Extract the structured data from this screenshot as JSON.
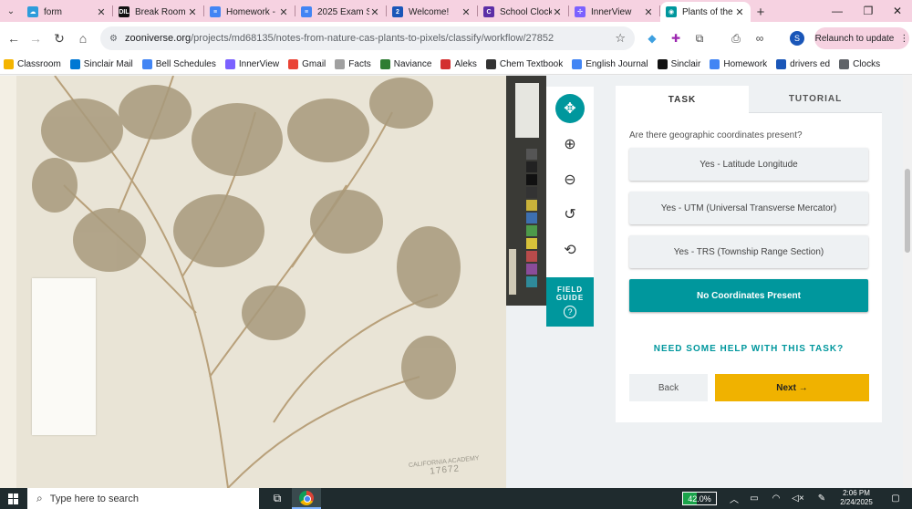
{
  "browser": {
    "tabs": [
      {
        "title": "form",
        "favicon_color": "#2d9cdb",
        "favicon_glyph": "☁"
      },
      {
        "title": "Break Room",
        "favicon_color": "#111111",
        "favicon_glyph": "DIL"
      },
      {
        "title": "Homework -",
        "favicon_color": "#4285f4",
        "favicon_glyph": "≡"
      },
      {
        "title": "2025 Exam S",
        "favicon_color": "#4285f4",
        "favicon_glyph": "≡"
      },
      {
        "title": "Welcome!",
        "favicon_color": "#1a56b8",
        "favicon_glyph": "2"
      },
      {
        "title": "School Clock",
        "favicon_color": "#5b2ea6",
        "favicon_glyph": "C"
      },
      {
        "title": "InnerView",
        "favicon_color": "#7b61ff",
        "favicon_glyph": "✢"
      },
      {
        "title": "Plants of the",
        "favicon_color": "#00979d",
        "favicon_glyph": "◉"
      }
    ],
    "url_domain": "zooniverse.org",
    "url_path": "/projects/md68135/notes-from-nature-cas-plants-to-pixels/classify/workflow/27852",
    "profile_initial": "S",
    "relaunch_label": "Relaunch to update",
    "bookmarks": [
      {
        "label": "Classroom",
        "color": "#f4b400"
      },
      {
        "label": "Sinclair Mail",
        "color": "#0078d4"
      },
      {
        "label": "Bell Schedules",
        "color": "#4285f4"
      },
      {
        "label": "InnerView",
        "color": "#7b61ff"
      },
      {
        "label": "Gmail",
        "color": "#ea4335"
      },
      {
        "label": "Facts",
        "color": "#a0a0a0"
      },
      {
        "label": "Naviance",
        "color": "#2e7d32"
      },
      {
        "label": "Aleks",
        "color": "#d32f2f"
      },
      {
        "label": "Chem Textbook",
        "color": "#333333"
      },
      {
        "label": "English Journal",
        "color": "#4285f4"
      },
      {
        "label": "Sinclair",
        "color": "#111111"
      },
      {
        "label": "Homework",
        "color": "#4285f4"
      },
      {
        "label": "drivers ed",
        "color": "#1a56b8"
      },
      {
        "label": "Clocks",
        "color": "#5f6368"
      }
    ]
  },
  "specimen": {
    "stamp_line1": "CALIFORNIA ACADEMY",
    "stamp_line2": "17672"
  },
  "toolbox": {
    "field_guide_line1": "FIELD",
    "field_guide_line2": "GUIDE",
    "field_guide_help": "?"
  },
  "task": {
    "tab_task": "TASK",
    "tab_tutorial": "TUTORIAL",
    "question": "Are there geographic coordinates present?",
    "answers": [
      "Yes - Latitude Longitude",
      "Yes - UTM (Universal Transverse Mercator)",
      "Yes - TRS (Township Range Section)",
      "No Coordinates Present"
    ],
    "selected_index": 3,
    "help_link": "NEED SOME HELP WITH THIS TASK?",
    "back_label": "Back",
    "next_label": "Next →",
    "accent_color": "#00979d",
    "next_color": "#f0b200"
  },
  "taskbar": {
    "search_placeholder": "Type here to search",
    "battery_percent": "42.0%",
    "battery_level": 0.42,
    "time": "2:06 PM",
    "date": "2/24/2025"
  }
}
